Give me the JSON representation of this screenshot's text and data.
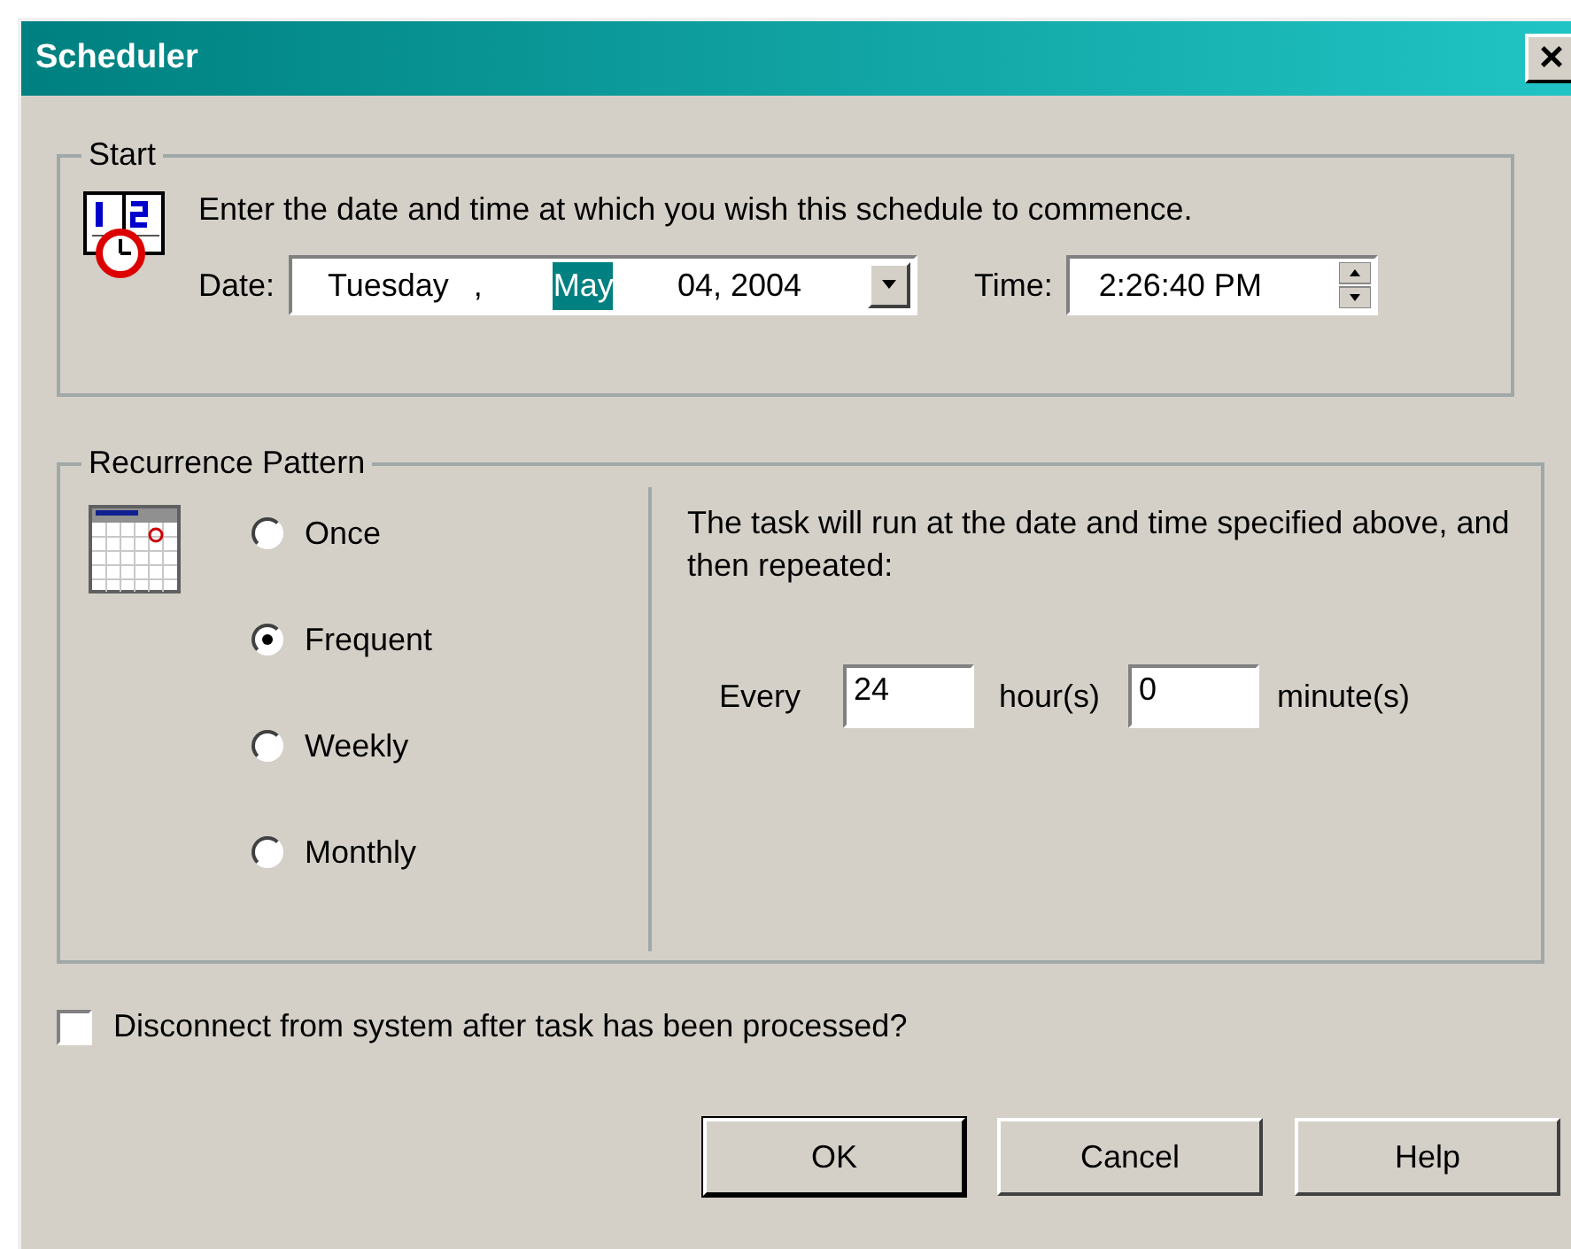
{
  "window": {
    "title": "Scheduler",
    "close": "×"
  },
  "start": {
    "legend": "Start",
    "description": "Enter the date and time at which you wish this schedule to commence.",
    "date": {
      "label": "Date:",
      "segments": [
        {
          "text": "Tuesday",
          "selected": false
        },
        {
          "text": ",",
          "selected": false
        },
        {
          "text": "May",
          "selected": true
        },
        {
          "text": "04, 2004",
          "selected": false
        }
      ]
    },
    "time": {
      "label": "Time:",
      "value": "2:26:40 PM"
    }
  },
  "recurrence": {
    "legend": "Recurrence Pattern",
    "options": [
      {
        "label": "Once",
        "selected": false
      },
      {
        "label": "Frequent",
        "selected": true
      },
      {
        "label": "Weekly",
        "selected": false
      },
      {
        "label": "Monthly",
        "selected": false
      }
    ],
    "description": "The task will run at the date and time specified above, and then repeated:",
    "every_label": "Every",
    "hours": "24",
    "hours_unit": "hour(s)",
    "minutes": "0",
    "minutes_unit": "minute(s)"
  },
  "disconnect": {
    "label": "Disconnect from system after task has been processed?",
    "checked": false
  },
  "buttons": [
    {
      "label": "OK",
      "default": true
    },
    {
      "label": "Cancel",
      "default": false
    },
    {
      "label": "Help",
      "default": false
    }
  ]
}
